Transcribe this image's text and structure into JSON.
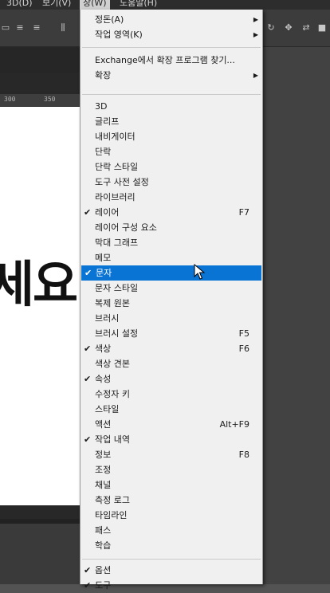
{
  "menubar": {
    "items": [
      {
        "label": "3D(D)"
      },
      {
        "label": "보기(V)"
      },
      {
        "label": "창(W)"
      },
      {
        "label": "도움말(H)"
      }
    ]
  },
  "ruler": {
    "ticks": [
      "300",
      "350"
    ]
  },
  "canvas": {
    "text": "세요."
  },
  "menu": {
    "group1": [
      {
        "label": "정돈(A)",
        "submenu": true
      },
      {
        "label": "작업 영역(K)",
        "submenu": true
      }
    ],
    "group2": [
      {
        "label": "Exchange에서 확장 프로그램 찾기...",
        "submenu": false
      },
      {
        "label": "확장",
        "submenu": true
      }
    ],
    "group3": [
      {
        "label": "3D",
        "checked": false,
        "shortcut": ""
      },
      {
        "label": "글리프",
        "checked": false,
        "shortcut": ""
      },
      {
        "label": "내비게이터",
        "checked": false,
        "shortcut": ""
      },
      {
        "label": "단락",
        "checked": false,
        "shortcut": ""
      },
      {
        "label": "단락 스타일",
        "checked": false,
        "shortcut": ""
      },
      {
        "label": "도구 사전 설정",
        "checked": false,
        "shortcut": ""
      },
      {
        "label": "라이브러리",
        "checked": false,
        "shortcut": ""
      },
      {
        "label": "레이어",
        "checked": true,
        "shortcut": "F7"
      },
      {
        "label": "레이어 구성 요소",
        "checked": false,
        "shortcut": ""
      },
      {
        "label": "막대 그래프",
        "checked": false,
        "shortcut": ""
      },
      {
        "label": "메모",
        "checked": false,
        "shortcut": ""
      },
      {
        "label": "문자",
        "checked": true,
        "shortcut": "",
        "highlighted": true
      },
      {
        "label": "문자 스타일",
        "checked": false,
        "shortcut": ""
      },
      {
        "label": "복제 원본",
        "checked": false,
        "shortcut": ""
      },
      {
        "label": "브러시",
        "checked": false,
        "shortcut": ""
      },
      {
        "label": "브러시 설정",
        "checked": false,
        "shortcut": "F5"
      },
      {
        "label": "색상",
        "checked": true,
        "shortcut": "F6"
      },
      {
        "label": "색상 견본",
        "checked": false,
        "shortcut": ""
      },
      {
        "label": "속성",
        "checked": true,
        "shortcut": ""
      },
      {
        "label": "수정자 키",
        "checked": false,
        "shortcut": ""
      },
      {
        "label": "스타일",
        "checked": false,
        "shortcut": ""
      },
      {
        "label": "액션",
        "checked": false,
        "shortcut": "Alt+F9"
      },
      {
        "label": "작업 내역",
        "checked": true,
        "shortcut": ""
      },
      {
        "label": "정보",
        "checked": false,
        "shortcut": "F8"
      },
      {
        "label": "조정",
        "checked": false,
        "shortcut": ""
      },
      {
        "label": "채널",
        "checked": false,
        "shortcut": ""
      },
      {
        "label": "측정 로그",
        "checked": false,
        "shortcut": ""
      },
      {
        "label": "타임라인",
        "checked": false,
        "shortcut": ""
      },
      {
        "label": "패스",
        "checked": false,
        "shortcut": ""
      },
      {
        "label": "학습",
        "checked": false,
        "shortcut": ""
      }
    ],
    "group4": [
      {
        "label": "옵션",
        "checked": true,
        "shortcut": ""
      },
      {
        "label": "도구",
        "checked": true,
        "shortcut": ""
      }
    ]
  },
  "icons": {
    "check": "✔",
    "submenu_arrow": "▶"
  },
  "colors": {
    "highlight": "#0a74d4",
    "menu_bg": "#f0f0f0",
    "app_bg": "#535353"
  }
}
